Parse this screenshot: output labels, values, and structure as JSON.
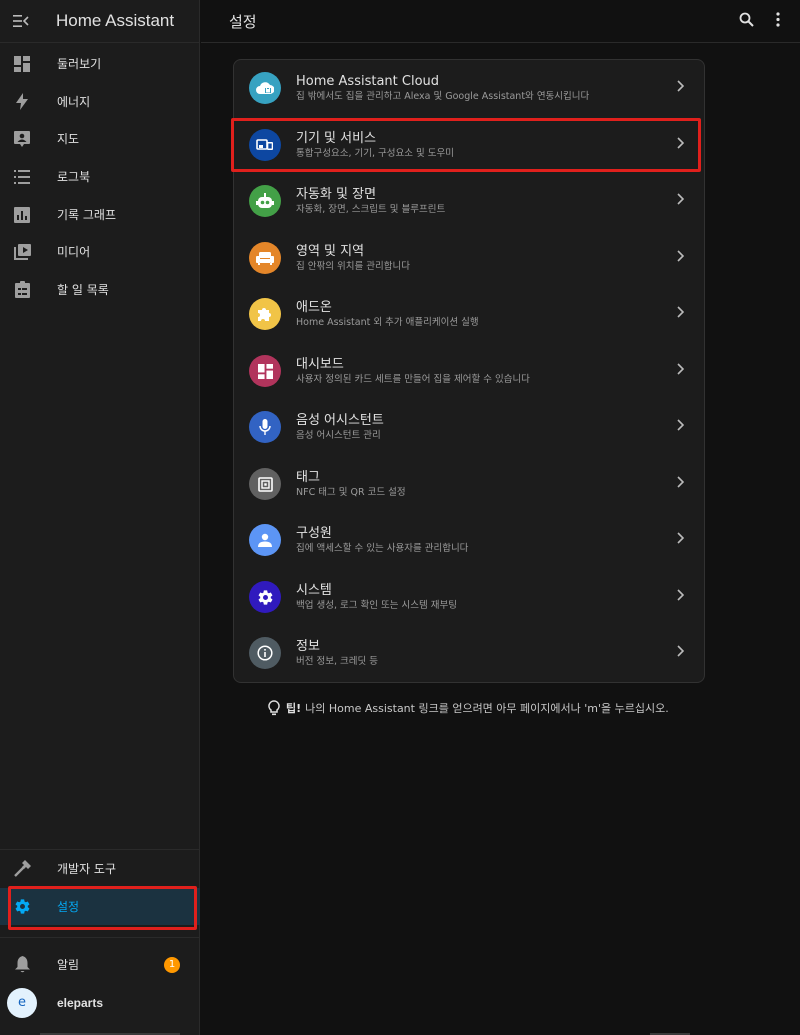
{
  "app": {
    "title": "Home Assistant"
  },
  "header": {
    "title": "설정"
  },
  "sidebar": {
    "items": [
      {
        "label": "둘러보기",
        "icon": "dashboard-icon"
      },
      {
        "label": "에너지",
        "icon": "lightning-icon"
      },
      {
        "label": "지도",
        "icon": "map-person-icon"
      },
      {
        "label": "로그북",
        "icon": "list-icon"
      },
      {
        "label": "기록 그래프",
        "icon": "chart-icon"
      },
      {
        "label": "미디어",
        "icon": "media-icon"
      },
      {
        "label": "할 일 목록",
        "icon": "clipboard-icon"
      }
    ],
    "dev_tools": {
      "label": "개발자 도구",
      "icon": "hammer-icon"
    },
    "settings": {
      "label": "설정",
      "icon": "gear-icon"
    },
    "notifications": {
      "label": "알림",
      "count": "1",
      "icon": "bell-icon"
    },
    "user": {
      "initial": "e",
      "name": "eleparts"
    }
  },
  "settings_list": [
    {
      "title": "Home Assistant Cloud",
      "subtitle": "집 밖에서도 집을 관리하고 Alexa 및 Google Assistant와 연동시킵니다",
      "color": "#37a2c1",
      "icon": "cloud-lock-icon"
    },
    {
      "title": "기기 및 서비스",
      "subtitle": "통합구성요소, 기기, 구성요소 및 도우미",
      "color": "#0d47a1",
      "icon": "devices-icon"
    },
    {
      "title": "자동화 및 장면",
      "subtitle": "자동화, 장면, 스크립트 및 블루프린트",
      "color": "#43a047",
      "icon": "robot-icon"
    },
    {
      "title": "영역 및 지역",
      "subtitle": "집 안팎의 위치를 관리합니다",
      "color": "#e48629",
      "icon": "sofa-icon"
    },
    {
      "title": "애드온",
      "subtitle": "Home Assistant 외 추가 애플리케이션 실행",
      "color": "#f1c447",
      "icon": "puzzle-icon"
    },
    {
      "title": "대시보드",
      "subtitle": "사용자 정의된 카드 세트를 만들어 집을 제어할 수 있습니다",
      "color": "#b1345c",
      "icon": "dashboard-tile-icon"
    },
    {
      "title": "음성 어시스턴트",
      "subtitle": "음성 어시스턴트 관리",
      "color": "#3263c3",
      "icon": "microphone-icon"
    },
    {
      "title": "태그",
      "subtitle": "NFC 태그 및 QR 코드 설정",
      "color": "#616161",
      "icon": "nfc-icon"
    },
    {
      "title": "구성원",
      "subtitle": "집에 액세스할 수 있는 사용자를 관리합니다",
      "color": "#5c95f5",
      "icon": "person-icon"
    },
    {
      "title": "시스템",
      "subtitle": "백업 생성, 로그 확인 또는 시스템 재부팅",
      "color": "#301abe",
      "icon": "gear-icon"
    },
    {
      "title": "정보",
      "subtitle": "버전 정보, 크레딧 등",
      "color": "#4f5b62",
      "icon": "info-icon"
    }
  ],
  "tip": {
    "label": "팁!",
    "text": "나의 Home Assistant 링크를 얻으려면 아무 페이지에서나 'm'을 누르십시오."
  }
}
